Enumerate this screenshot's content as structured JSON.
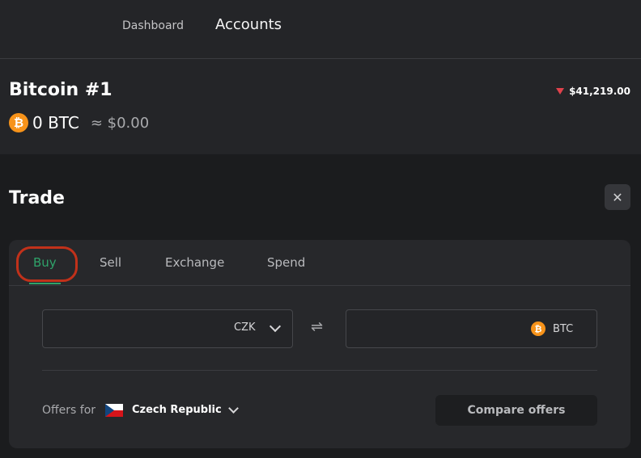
{
  "nav": {
    "dashboard": "Dashboard",
    "accounts": "Accounts"
  },
  "account": {
    "name": "Bitcoin #1",
    "price": "$41,219.00",
    "price_trend": "down",
    "coin_icon": "₿",
    "balance": "0 BTC",
    "fiat_approx": "≈ $0.00"
  },
  "trade": {
    "title": "Trade",
    "close_icon": "✕",
    "tabs": [
      "Buy",
      "Sell",
      "Exchange",
      "Spend"
    ],
    "active_tab": "Buy",
    "from_currency": "CZK",
    "to_currency": "BTC",
    "swap_icon": "⇌",
    "offers_for_label": "Offers for",
    "country": "Czech Republic",
    "compare_button": "Compare offers"
  },
  "colors": {
    "accent_green": "#2fa36a",
    "highlight_red": "#c1311a",
    "price_down": "#e0424c",
    "btc_orange": "#f7931a"
  }
}
